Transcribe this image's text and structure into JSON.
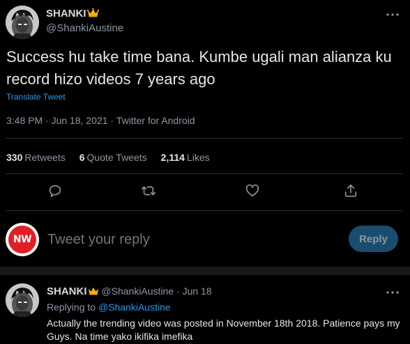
{
  "main_tweet": {
    "author_name": "SHANKI",
    "author_handle": "@ShankiAustine",
    "text": "Success hu take time bana. Kumbe ugali man alianza ku record hizo videos 7 years ago",
    "translate_label": "Translate Tweet",
    "meta": "3:48 PM · Jun 18, 2021 · Twitter for Android",
    "stats": {
      "retweets_count": "330",
      "retweets_label": "Retweets",
      "quote_count": "6",
      "quote_label": "Quote Tweets",
      "likes_count": "2,114",
      "likes_label": "Likes"
    },
    "actions": [
      "reply-icon",
      "retweet-icon",
      "like-icon",
      "share-icon"
    ]
  },
  "reply_box": {
    "avatar_text": "NW",
    "placeholder": "Tweet your reply",
    "button_label": "Reply"
  },
  "reply_tweet": {
    "author_name": "SHANKI",
    "author_handle": "@ShankiAustine",
    "date": "· Jun 18",
    "replying_prefix": "Replying to",
    "replying_handle": "@ShankiAustine",
    "text": "Actually the trending video was posted in November 18th 2018. Patience pays my Guys. Na time yako ikifika imefika"
  },
  "colors": {
    "background": "#000000",
    "accent": "#1d9bf0",
    "secondary_text": "#8b98a5",
    "reply_button": "#1a4c6e",
    "brand_red": "#e01f26"
  }
}
